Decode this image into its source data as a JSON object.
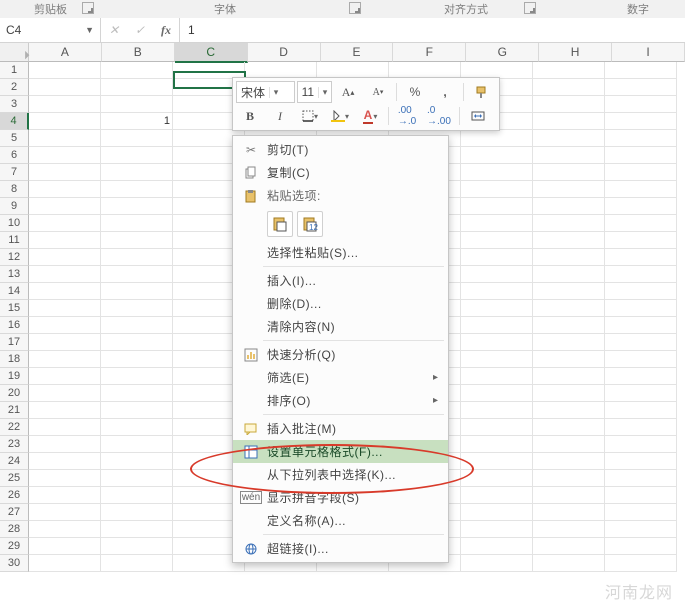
{
  "groups": {
    "clipboard": "剪贴板",
    "font": "字体",
    "align": "对齐方式",
    "number": "数字"
  },
  "namebox": "C4",
  "formula_value": "1",
  "columns": [
    "A",
    "B",
    "C",
    "D",
    "E",
    "F",
    "G",
    "H",
    "I"
  ],
  "selected_col": "C",
  "selected_row": 4,
  "row_count": 30,
  "cells": {
    "B4": "1",
    "C4": "1"
  },
  "minibar": {
    "font_name": "宋体",
    "font_size": "11",
    "btns": {
      "bold": "B",
      "italic": "I",
      "percent": "%",
      "comma": ",",
      "inc": "A",
      "dec": "A"
    }
  },
  "ctx": {
    "cut": "剪切(T)",
    "copy": "复制(C)",
    "paste_hdr": "粘贴选项:",
    "paste_special": "选择性粘贴(S)...",
    "insert": "插入(I)...",
    "delete": "删除(D)...",
    "clear": "清除内容(N)",
    "quick": "快速分析(Q)",
    "filter": "筛选(E)",
    "sort": "排序(O)",
    "comment": "插入批注(M)",
    "format": "设置单元格格式(F)...",
    "dropdown": "从下拉列表中选择(K)...",
    "pinyin": "显示拼音字段(S)",
    "name": "定义名称(A)...",
    "hyperlink": "超链接(I)..."
  },
  "watermark": "河南龙网"
}
